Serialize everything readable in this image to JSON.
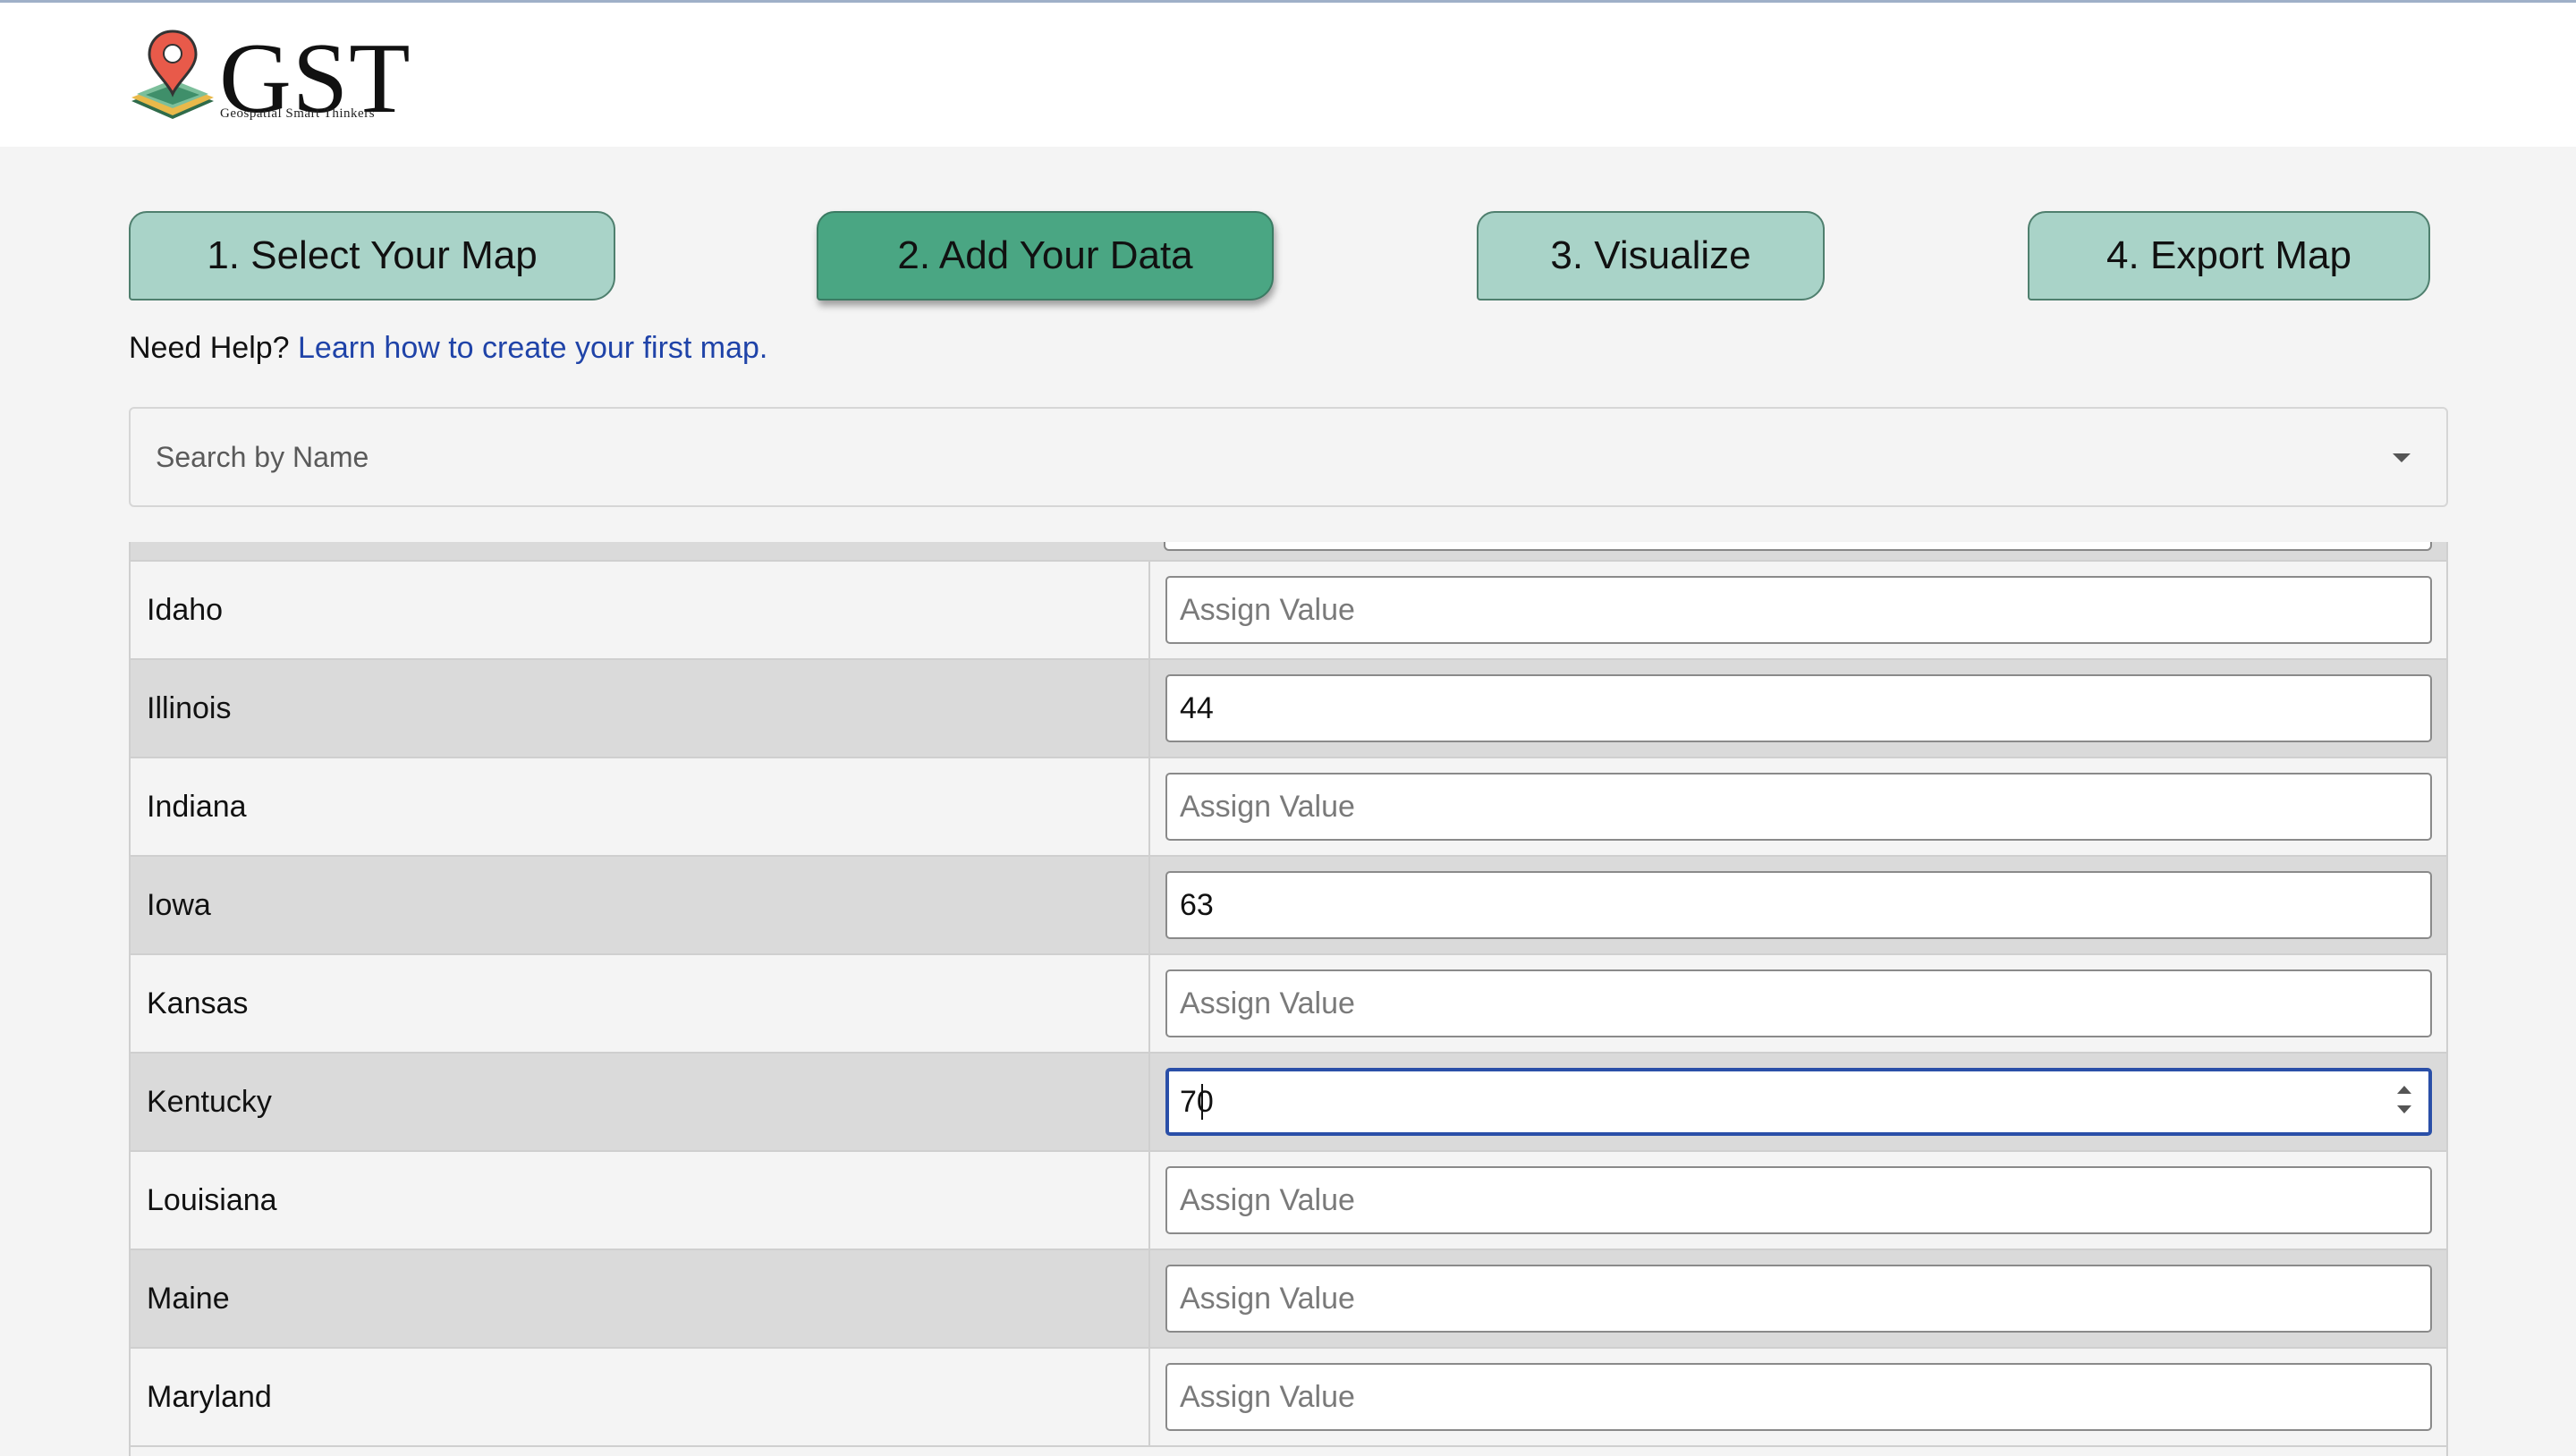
{
  "header": {
    "logo_text": "GST",
    "logo_subtitle": "Geospatial Smart Thinkers",
    "logo_icon": "map-pin-layers-icon"
  },
  "steps": [
    {
      "label": "1. Select Your Map",
      "active": false
    },
    {
      "label": "2. Add Your Data",
      "active": true
    },
    {
      "label": "3. Visualize",
      "active": false
    },
    {
      "label": "4. Export Map",
      "active": false
    }
  ],
  "help": {
    "prefix": "Need Help?",
    "link_text": "Learn how to create your first map."
  },
  "search": {
    "placeholder": "Search by Name",
    "icon": "caret-down-icon"
  },
  "table": {
    "value_placeholder": "Assign Value",
    "rows": [
      {
        "name": "Idaho",
        "value": ""
      },
      {
        "name": "Illinois",
        "value": "44"
      },
      {
        "name": "Indiana",
        "value": ""
      },
      {
        "name": "Iowa",
        "value": "63"
      },
      {
        "name": "Kansas",
        "value": ""
      },
      {
        "name": "Kentucky",
        "value": "70",
        "focused": true
      },
      {
        "name": "Louisiana",
        "value": ""
      },
      {
        "name": "Maine",
        "value": ""
      },
      {
        "name": "Maryland",
        "value": ""
      }
    ]
  },
  "colors": {
    "step_inactive": "#a9d3c8",
    "step_active": "#4aa683",
    "link": "#1f43a8",
    "focus_border": "#2a4fa8"
  }
}
